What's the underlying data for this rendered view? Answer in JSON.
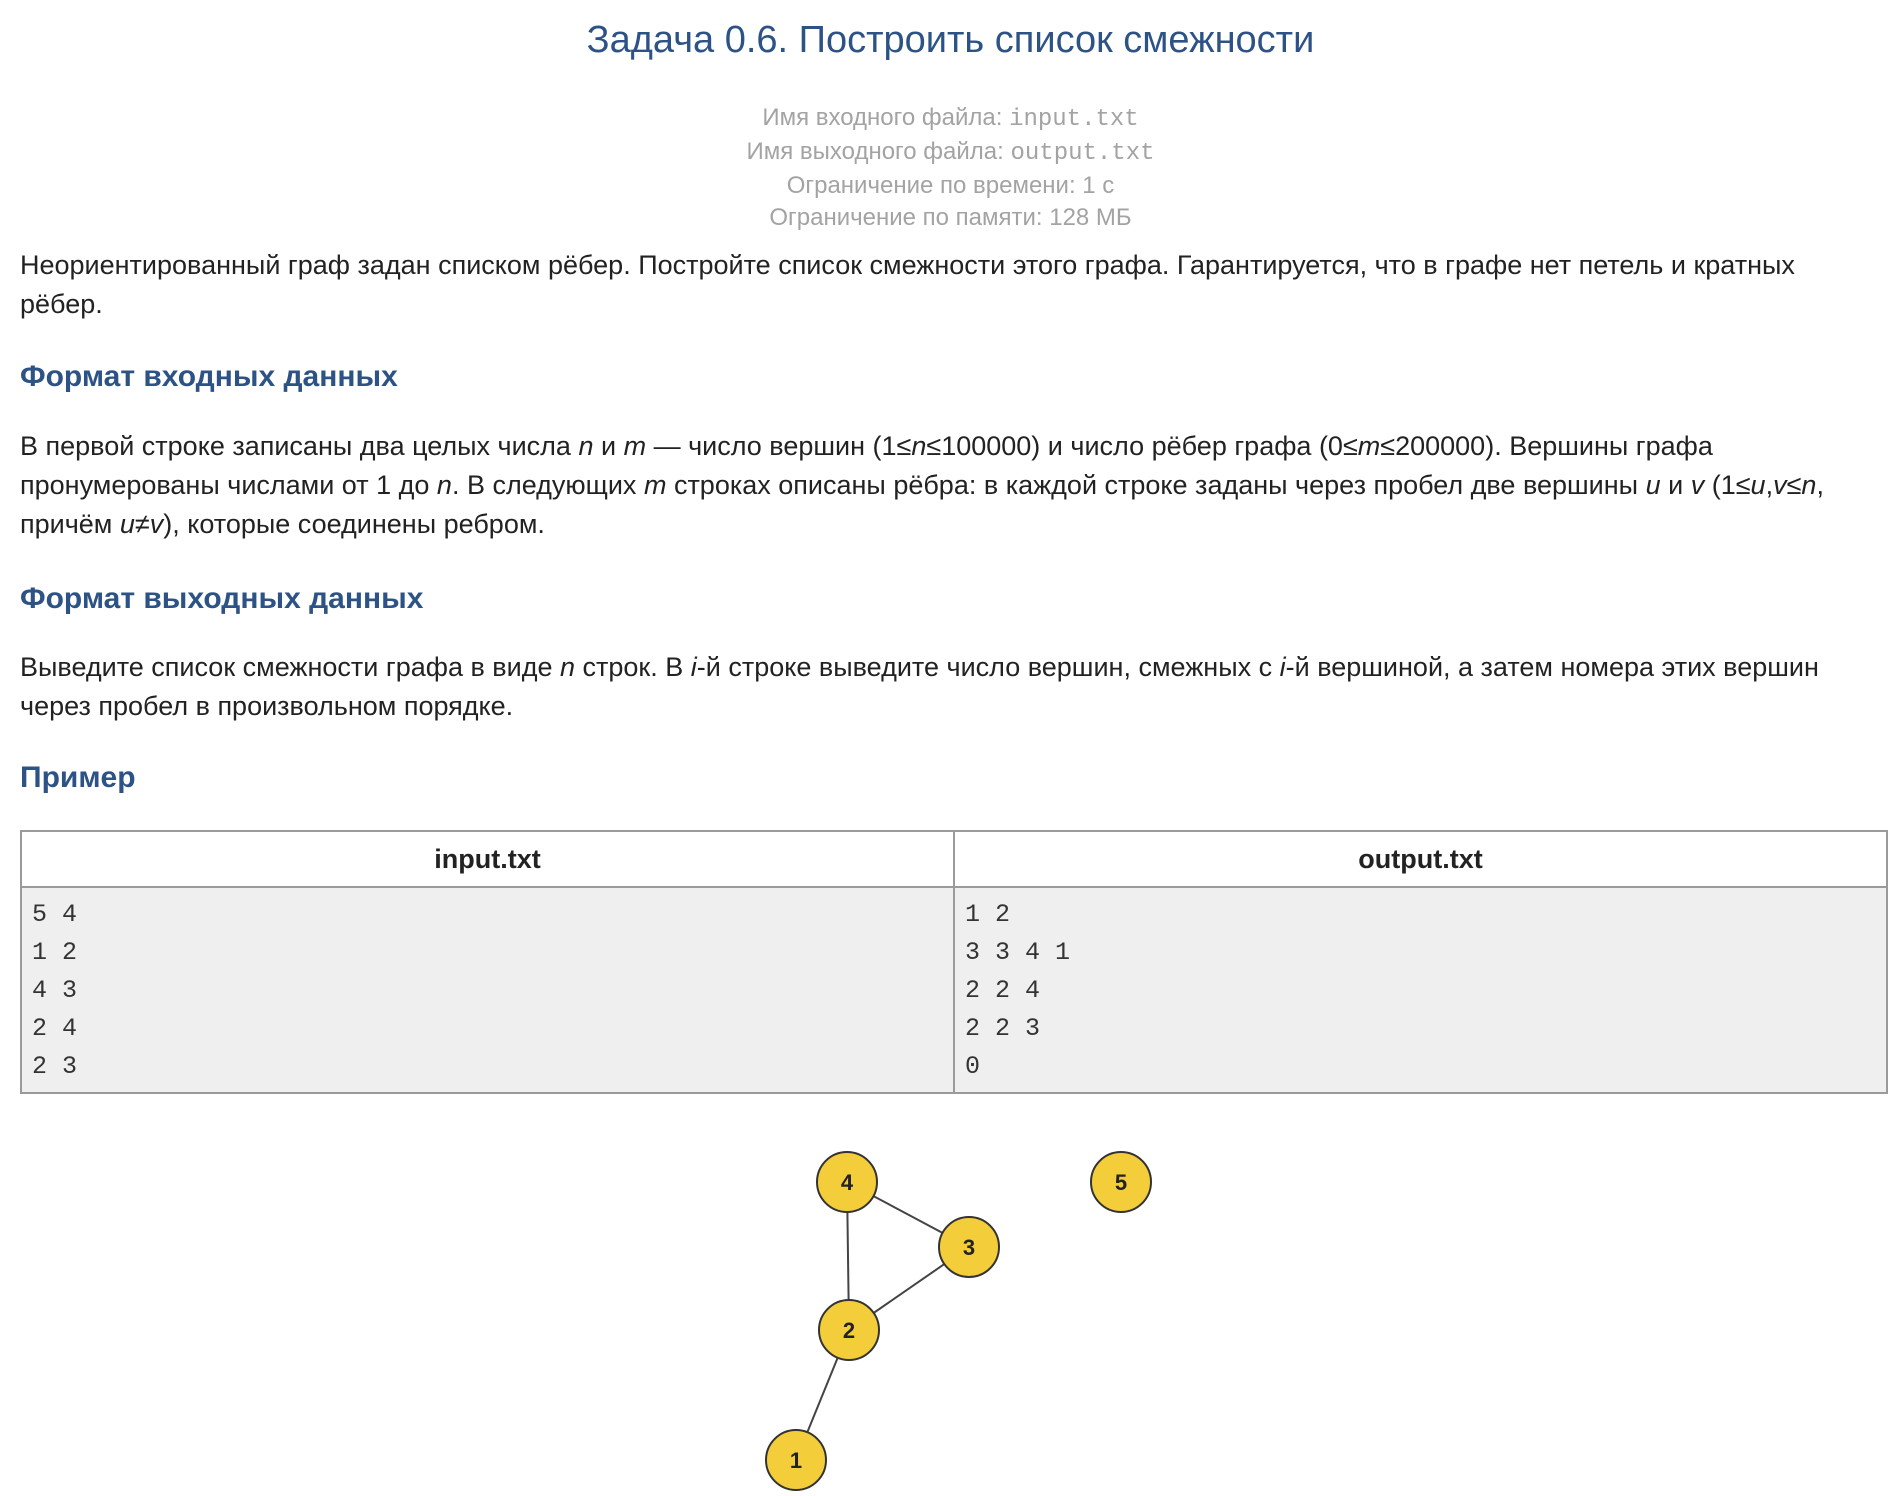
{
  "problem": {
    "title": "Задача 0.6. Построить список смежности",
    "limits": {
      "input_label": "Имя входного файла: ",
      "input_file": "input.txt",
      "output_label": "Имя выходного файла: ",
      "output_file": "output.txt",
      "time": "Ограничение по времени: 1 с",
      "memory": "Ограничение по памяти: 128 МБ"
    },
    "statement": "Неориентированный граф задан списком рёбер. Постройте список смежности этого графа. Гарантируется, что в графе нет петель и кратных рёбер."
  },
  "input_format": {
    "heading": "Формат входных данных",
    "parts": [
      {
        "t": "В первой строке записаны два целых числа "
      },
      {
        "t": "n",
        "v": true
      },
      {
        "t": " и "
      },
      {
        "t": "m",
        "v": true
      },
      {
        "t": " — число вершин (1≤"
      },
      {
        "t": "n",
        "v": true
      },
      {
        "t": "≤100000) и число рёбер графа (0≤"
      },
      {
        "t": "m",
        "v": true
      },
      {
        "t": "≤200000). Вершины графа пронумерованы числами от 1 до "
      },
      {
        "t": "n",
        "v": true
      },
      {
        "t": ". В следующих "
      },
      {
        "t": "m",
        "v": true
      },
      {
        "t": " строках описаны рёбра: в каждой строке заданы через пробел две вершины "
      },
      {
        "t": "u",
        "v": true
      },
      {
        "t": " и "
      },
      {
        "t": "v",
        "v": true
      },
      {
        "t": " (1≤"
      },
      {
        "t": "u",
        "v": true
      },
      {
        "t": ","
      },
      {
        "t": "v",
        "v": true
      },
      {
        "t": "≤"
      },
      {
        "t": "n",
        "v": true
      },
      {
        "t": ", причём "
      },
      {
        "t": "u",
        "v": true
      },
      {
        "t": "≠"
      },
      {
        "t": "v",
        "v": true
      },
      {
        "t": "), которые соединены ребром."
      }
    ]
  },
  "output_format": {
    "heading": "Формат выходных данных",
    "parts": [
      {
        "t": "Выведите список смежности графа в виде "
      },
      {
        "t": "n",
        "v": true
      },
      {
        "t": " строк. В "
      },
      {
        "t": "i",
        "v": true
      },
      {
        "t": "-й строке выведите число вершин, смежных с "
      },
      {
        "t": "i",
        "v": true
      },
      {
        "t": "-й вершиной, а затем номера этих вершин через пробел в произвольном порядке."
      }
    ]
  },
  "example": {
    "heading": "Пример",
    "input_header": "input.txt",
    "output_header": "output.txt",
    "input_lines": [
      "5 4",
      "1 2",
      "4 3",
      "2 4",
      "2 3"
    ],
    "output_lines": [
      "1 2",
      "3 3 4 1",
      "2 2 4",
      "2 2 3",
      "0"
    ]
  },
  "graph": {
    "vertices": [
      "1",
      "2",
      "3",
      "4",
      "5"
    ],
    "edges": [
      [
        "1",
        "2"
      ],
      [
        "4",
        "3"
      ],
      [
        "2",
        "4"
      ],
      [
        "2",
        "3"
      ]
    ],
    "node_fill": "#f4cd3a",
    "node_stroke": "#333333",
    "edge_color": "#444444"
  }
}
